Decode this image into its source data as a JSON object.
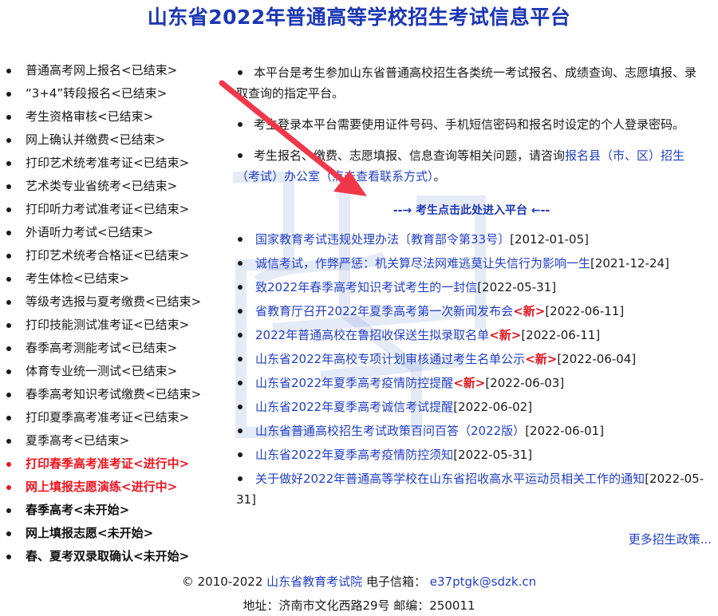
{
  "title": "山东省2022年普通高等学校招生考试信息平台",
  "left_menu": [
    {
      "label": "普通高考网上报名<已结束>",
      "status": "done"
    },
    {
      "label": "“3+4”转段报名<已结束>",
      "status": "done"
    },
    {
      "label": "考生资格审核<已结束>",
      "status": "done"
    },
    {
      "label": "网上确认并缴费<已结束>",
      "status": "done"
    },
    {
      "label": "打印艺术统考准考证<已结束>",
      "status": "done"
    },
    {
      "label": "艺术类专业省统考<已结束>",
      "status": "done"
    },
    {
      "label": "打印听力考试准考证<已结束>",
      "status": "done"
    },
    {
      "label": "外语听力考试<已结束>",
      "status": "done"
    },
    {
      "label": "打印艺术统考合格证<已结束>",
      "status": "done"
    },
    {
      "label": "考生体检<已结束>",
      "status": "done"
    },
    {
      "label": "等级考选报与夏考缴费<已结束>",
      "status": "done"
    },
    {
      "label": "打印技能测试准考证<已结束>",
      "status": "done"
    },
    {
      "label": "春季高考测能考试<已结束>",
      "status": "done"
    },
    {
      "label": "体育专业统一测试<已结束>",
      "status": "done"
    },
    {
      "label": "春季高考知识考试缴费<已结束>",
      "status": "done"
    },
    {
      "label": "打印夏季高考准考证<已结束>",
      "status": "done"
    },
    {
      "label": "夏季高考<已结束>",
      "status": "done"
    },
    {
      "label": "打印春季高考准考证<进行中>",
      "status": "active"
    },
    {
      "label": "网上填报志愿演练<进行中>",
      "status": "active"
    },
    {
      "label": "春季高考<未开始>",
      "status": "pending"
    },
    {
      "label": "网上填报志愿<未开始>",
      "status": "pending"
    },
    {
      "label": "春、夏考双录取确认<未开始>",
      "status": "pending"
    }
  ],
  "intro": {
    "p1": "本平台是考生参加山东省普通高校招生各类统一考试报名、成绩查询、志愿填报、录取查询的指定平台。",
    "p2": "考生登录本平台需要使用证件号码、手机短信密码和报名时设定的个人登录密码。",
    "p3_text": "考生报名、缴费、志愿填报、信息查询等相关问题，请咨询",
    "p3_link": "报名县（市、区）招生（考试）办公室（点击查看联系方式）",
    "p3_end": "。"
  },
  "enter_link": "--→ 考生点击此处进入平台 ←--",
  "news": [
    {
      "title": "国家教育考试违规处理办法〔教育部令第33号〕",
      "new": "",
      "date": "[2012-01-05]"
    },
    {
      "title": "诚信考试，作弊严惩：机关算尽法网难逃莫让失信行为影响一生",
      "new": "",
      "date": "[2021-12-24]"
    },
    {
      "title": "致2022年春季高考知识考试考生的一封信",
      "new": "",
      "date": "[2022-05-31]"
    },
    {
      "title": "省教育厅召开2022年夏季高考第一次新闻发布会",
      "new": "<新>",
      "date": "[2022-06-11]"
    },
    {
      "title": "2022年普通高校在鲁招收保送生拟录取名单",
      "new": "<新>",
      "date": "[2022-06-11]"
    },
    {
      "title": "山东省2022年高校专项计划审核通过考生名单公示",
      "new": "<新>",
      "date": "[2022-06-04]"
    },
    {
      "title": "山东省2022年夏季高考疫情防控提醒",
      "new": "<新>",
      "date": "[2022-06-03]"
    },
    {
      "title": "山东省2022年夏季高考诚信考试提醒",
      "new": "",
      "date": "[2022-06-02]"
    },
    {
      "title": "山东省普通高校招生考试政策百问百答（2022版）",
      "new": "",
      "date": "[2022-06-01]"
    },
    {
      "title": "山东省2022年夏季高考疫情防控须知",
      "new": "",
      "date": "[2022-05-31]"
    },
    {
      "title": "关于做好2022年普通高等学校在山东省招收高水平运动员相关工作的通知",
      "new": "",
      "date": "[2022-05-31]"
    }
  ],
  "more_link": "更多招生政策...",
  "footer": {
    "copyright": "© 2010-2022",
    "org": "山东省教育考试院",
    "email_label": "电子信箱：",
    "email": "e37ptgk@sdzk.cn",
    "address": "地址：济南市文化西路29号 邮编：250011"
  },
  "colors": {
    "brand": "#1c37b5",
    "link": "#2340c6",
    "active": "#f0141e",
    "arrow": "#f0384a"
  }
}
